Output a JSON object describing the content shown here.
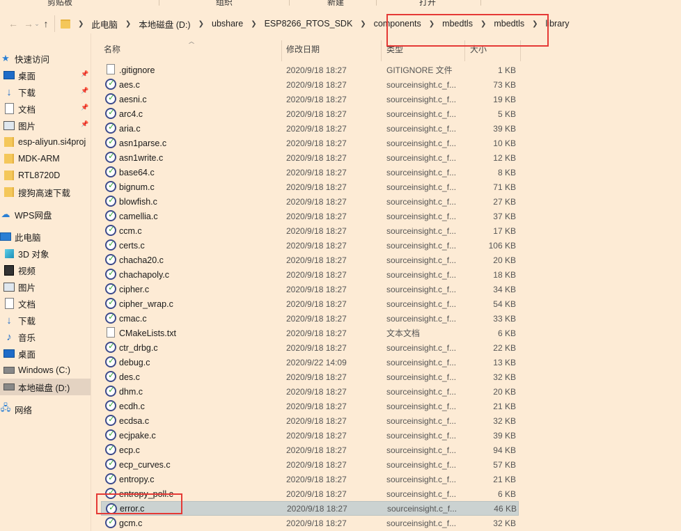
{
  "ribbon": {
    "labels": [
      "剪贴板",
      "组织",
      "新建",
      "打开"
    ]
  },
  "address": {
    "breadcrumbs": [
      "此电脑",
      "本地磁盘 (D:)",
      "ubshare",
      "ESP8266_RTOS_SDK",
      "components",
      "mbedtls",
      "mbedtls",
      "library"
    ]
  },
  "columns": {
    "name": "名称",
    "date": "修改日期",
    "type": "类型",
    "size": "大小"
  },
  "sidebar": {
    "items": [
      {
        "label": "快速访问",
        "icon": "star-icon"
      },
      {
        "label": "桌面",
        "icon": "desktop-icon",
        "pinned": true
      },
      {
        "label": "下载",
        "icon": "download-icon",
        "pinned": true
      },
      {
        "label": "文档",
        "icon": "document-icon",
        "pinned": true
      },
      {
        "label": "图片",
        "icon": "picture-icon",
        "pinned": true
      },
      {
        "label": "esp-aliyun.si4proj",
        "icon": "folder-icon"
      },
      {
        "label": "MDK-ARM",
        "icon": "folder-icon"
      },
      {
        "label": "RTL8720D",
        "icon": "folder-icon"
      },
      {
        "label": "搜狗高速下载",
        "icon": "folder-icon"
      },
      {
        "label": "WPS网盘",
        "icon": "cloud-icon"
      },
      {
        "label": "此电脑",
        "icon": "computer-icon"
      },
      {
        "label": "3D 对象",
        "icon": "3d-objects-icon"
      },
      {
        "label": "视频",
        "icon": "video-icon"
      },
      {
        "label": "图片",
        "icon": "picture-icon"
      },
      {
        "label": "文档",
        "icon": "document-icon"
      },
      {
        "label": "下载",
        "icon": "download-icon"
      },
      {
        "label": "音乐",
        "icon": "music-icon"
      },
      {
        "label": "桌面",
        "icon": "desktop-icon"
      },
      {
        "label": "Windows (C:)",
        "icon": "drive-icon"
      },
      {
        "label": "本地磁盘 (D:)",
        "icon": "drive-icon",
        "selected": true
      },
      {
        "label": "网络",
        "icon": "network-icon"
      }
    ]
  },
  "files": [
    {
      "name": ".gitignore",
      "date": "2020/9/18 18:27",
      "type": "GITIGNORE 文件",
      "size": "1 KB",
      "icon": "blank-file-icon"
    },
    {
      "name": "aes.c",
      "date": "2020/9/18 18:27",
      "type": "sourceinsight.c_f...",
      "size": "73 KB",
      "icon": "sourceinsight-icon"
    },
    {
      "name": "aesni.c",
      "date": "2020/9/18 18:27",
      "type": "sourceinsight.c_f...",
      "size": "19 KB",
      "icon": "sourceinsight-icon"
    },
    {
      "name": "arc4.c",
      "date": "2020/9/18 18:27",
      "type": "sourceinsight.c_f...",
      "size": "5 KB",
      "icon": "sourceinsight-icon"
    },
    {
      "name": "aria.c",
      "date": "2020/9/18 18:27",
      "type": "sourceinsight.c_f...",
      "size": "39 KB",
      "icon": "sourceinsight-icon"
    },
    {
      "name": "asn1parse.c",
      "date": "2020/9/18 18:27",
      "type": "sourceinsight.c_f...",
      "size": "10 KB",
      "icon": "sourceinsight-icon"
    },
    {
      "name": "asn1write.c",
      "date": "2020/9/18 18:27",
      "type": "sourceinsight.c_f...",
      "size": "12 KB",
      "icon": "sourceinsight-icon"
    },
    {
      "name": "base64.c",
      "date": "2020/9/18 18:27",
      "type": "sourceinsight.c_f...",
      "size": "8 KB",
      "icon": "sourceinsight-icon"
    },
    {
      "name": "bignum.c",
      "date": "2020/9/18 18:27",
      "type": "sourceinsight.c_f...",
      "size": "71 KB",
      "icon": "sourceinsight-icon"
    },
    {
      "name": "blowfish.c",
      "date": "2020/9/18 18:27",
      "type": "sourceinsight.c_f...",
      "size": "27 KB",
      "icon": "sourceinsight-icon"
    },
    {
      "name": "camellia.c",
      "date": "2020/9/18 18:27",
      "type": "sourceinsight.c_f...",
      "size": "37 KB",
      "icon": "sourceinsight-icon"
    },
    {
      "name": "ccm.c",
      "date": "2020/9/18 18:27",
      "type": "sourceinsight.c_f...",
      "size": "17 KB",
      "icon": "sourceinsight-icon"
    },
    {
      "name": "certs.c",
      "date": "2020/9/18 18:27",
      "type": "sourceinsight.c_f...",
      "size": "106 KB",
      "icon": "sourceinsight-icon"
    },
    {
      "name": "chacha20.c",
      "date": "2020/9/18 18:27",
      "type": "sourceinsight.c_f...",
      "size": "20 KB",
      "icon": "sourceinsight-icon"
    },
    {
      "name": "chachapoly.c",
      "date": "2020/9/18 18:27",
      "type": "sourceinsight.c_f...",
      "size": "18 KB",
      "icon": "sourceinsight-icon"
    },
    {
      "name": "cipher.c",
      "date": "2020/9/18 18:27",
      "type": "sourceinsight.c_f...",
      "size": "34 KB",
      "icon": "sourceinsight-icon"
    },
    {
      "name": "cipher_wrap.c",
      "date": "2020/9/18 18:27",
      "type": "sourceinsight.c_f...",
      "size": "54 KB",
      "icon": "sourceinsight-icon"
    },
    {
      "name": "cmac.c",
      "date": "2020/9/18 18:27",
      "type": "sourceinsight.c_f...",
      "size": "33 KB",
      "icon": "sourceinsight-icon"
    },
    {
      "name": "CMakeLists.txt",
      "date": "2020/9/18 18:27",
      "type": "文本文档",
      "size": "6 KB",
      "icon": "text-file-icon"
    },
    {
      "name": "ctr_drbg.c",
      "date": "2020/9/18 18:27",
      "type": "sourceinsight.c_f...",
      "size": "22 KB",
      "icon": "sourceinsight-icon"
    },
    {
      "name": "debug.c",
      "date": "2020/9/22 14:09",
      "type": "sourceinsight.c_f...",
      "size": "13 KB",
      "icon": "sourceinsight-icon"
    },
    {
      "name": "des.c",
      "date": "2020/9/18 18:27",
      "type": "sourceinsight.c_f...",
      "size": "32 KB",
      "icon": "sourceinsight-icon"
    },
    {
      "name": "dhm.c",
      "date": "2020/9/18 18:27",
      "type": "sourceinsight.c_f...",
      "size": "20 KB",
      "icon": "sourceinsight-icon"
    },
    {
      "name": "ecdh.c",
      "date": "2020/9/18 18:27",
      "type": "sourceinsight.c_f...",
      "size": "21 KB",
      "icon": "sourceinsight-icon"
    },
    {
      "name": "ecdsa.c",
      "date": "2020/9/18 18:27",
      "type": "sourceinsight.c_f...",
      "size": "32 KB",
      "icon": "sourceinsight-icon"
    },
    {
      "name": "ecjpake.c",
      "date": "2020/9/18 18:27",
      "type": "sourceinsight.c_f...",
      "size": "39 KB",
      "icon": "sourceinsight-icon"
    },
    {
      "name": "ecp.c",
      "date": "2020/9/18 18:27",
      "type": "sourceinsight.c_f...",
      "size": "94 KB",
      "icon": "sourceinsight-icon"
    },
    {
      "name": "ecp_curves.c",
      "date": "2020/9/18 18:27",
      "type": "sourceinsight.c_f...",
      "size": "57 KB",
      "icon": "sourceinsight-icon"
    },
    {
      "name": "entropy.c",
      "date": "2020/9/18 18:27",
      "type": "sourceinsight.c_f...",
      "size": "21 KB",
      "icon": "sourceinsight-icon"
    },
    {
      "name": "entropy_poll.c",
      "date": "2020/9/18 18:27",
      "type": "sourceinsight.c_f...",
      "size": "6 KB",
      "icon": "sourceinsight-icon"
    },
    {
      "name": "error.c",
      "date": "2020/9/18 18:27",
      "type": "sourceinsight.c_f...",
      "size": "46 KB",
      "icon": "sourceinsight-icon",
      "selected": true
    },
    {
      "name": "gcm.c",
      "date": "2020/9/18 18:27",
      "type": "sourceinsight.c_f...",
      "size": "32 KB",
      "icon": "sourceinsight-icon"
    }
  ]
}
